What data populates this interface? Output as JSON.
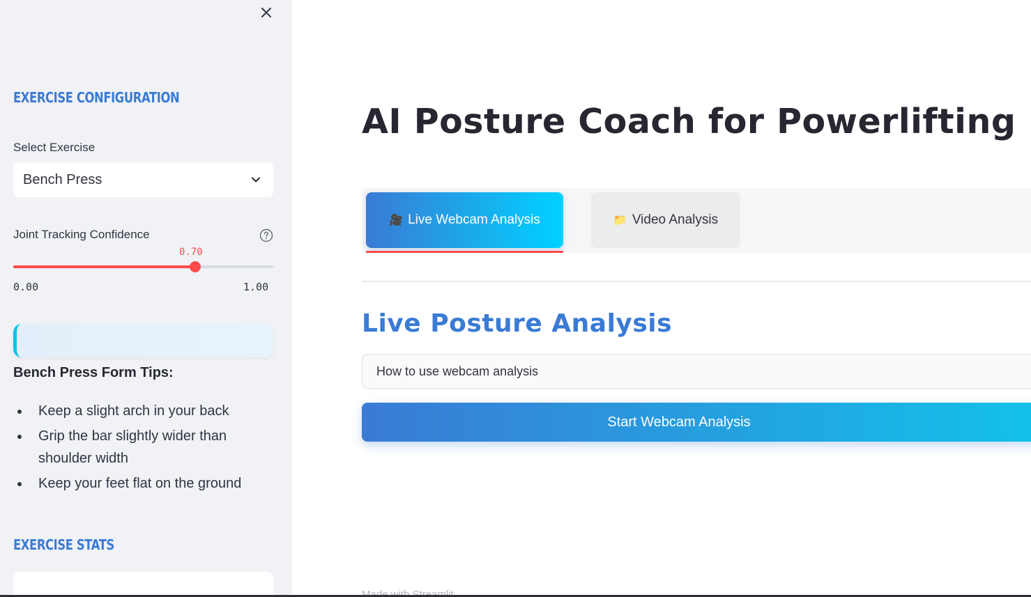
{
  "sidebar": {
    "config_heading": "Exercise Configuration",
    "select_label": "Select Exercise",
    "selected_exercise": "Bench Press",
    "slider": {
      "label": "Joint Tracking Confidence",
      "value_text": "0.70",
      "value": 0.7,
      "min_text": "0.00",
      "max_text": "1.00",
      "min": 0,
      "max": 1
    },
    "tips_title": "Bench Press Form Tips:",
    "tips": [
      "Keep a slight arch in your back",
      "Grip the bar slightly wider than shoulder width",
      "Keep your feet flat on the ground"
    ],
    "stats_heading": "Exercise Stats"
  },
  "main": {
    "title": "AI Posture Coach for Powerlifting",
    "tabs": [
      {
        "icon": "🎥",
        "label": "Live Webcam Analysis",
        "active": true
      },
      {
        "icon": "📁",
        "label": "Video Analysis",
        "active": false
      }
    ],
    "section_title": "Live Posture Analysis",
    "expander_label": "How to use webcam analysis",
    "start_button": "Start Webcam Analysis",
    "footer": "Made with Streamlit"
  },
  "colors": {
    "accent": "#3a7bd5",
    "accent_end": "#00d2ff",
    "slider": "#ff4b4b",
    "sidebar_bg": "#f0f2f6"
  },
  "icons": [
    "close-icon",
    "chevron-down-icon",
    "help-icon",
    "video-camera-icon",
    "folder-icon"
  ]
}
